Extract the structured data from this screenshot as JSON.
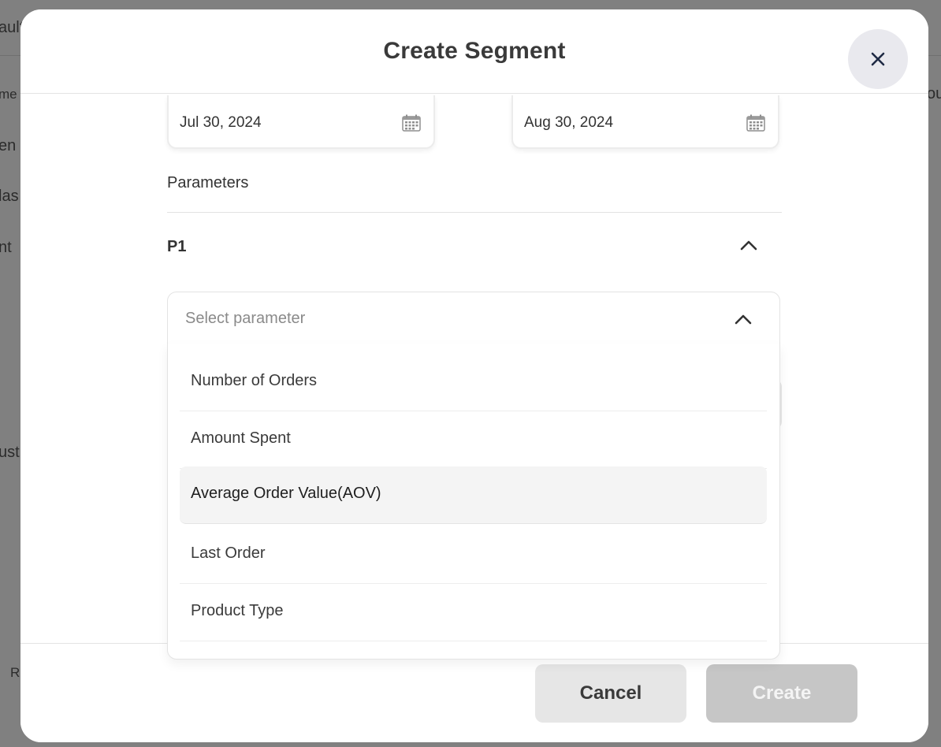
{
  "background_page": {
    "fragments": [
      "ault",
      "me",
      "ou",
      "en",
      "las",
      "nt",
      "ust",
      "R"
    ]
  },
  "modal": {
    "title": "Create Segment",
    "close_icon": "close-icon",
    "start_date": "Jul 30, 2024",
    "end_date": "Aug 30, 2024",
    "calendar_icon": "calendar-icon",
    "parameters_label": "Parameters",
    "parameter_group": "P1",
    "select": {
      "placeholder": "Select parameter",
      "options": [
        "Number of Orders",
        "Amount Spent",
        "Average Order Value(AOV)",
        "Last Order",
        "Product Type"
      ],
      "highlighted": "Average Order Value(AOV)"
    },
    "cancel_label": "Cancel",
    "create_label": "Create"
  },
  "colors": {
    "overlay": "#808080",
    "modal_bg": "#ffffff",
    "cancel_bg": "#e6e6e6",
    "create_bg_disabled": "#c6c6c6",
    "close_bg": "#e9e9ee",
    "highlight_bg": "#f4f4f4"
  }
}
